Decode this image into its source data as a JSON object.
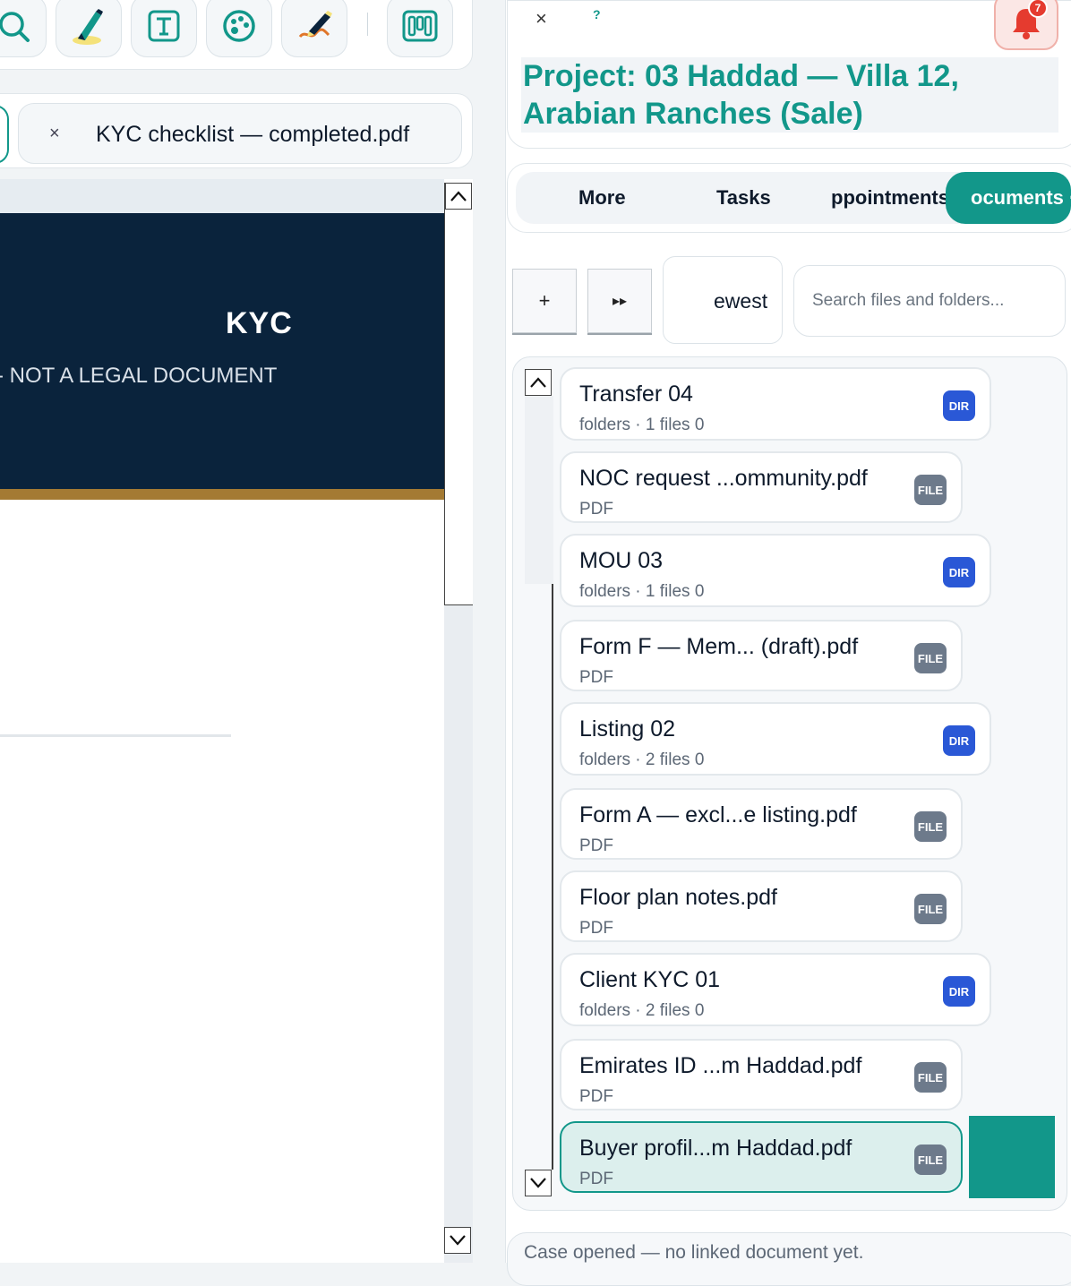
{
  "toolbar": {
    "tools": [
      {
        "icon": "search-icon"
      },
      {
        "icon": "highlighter-icon"
      },
      {
        "icon": "text-box-icon"
      },
      {
        "icon": "palette-icon"
      },
      {
        "icon": "signature-pen-icon"
      },
      {
        "icon": "columns-icon"
      }
    ]
  },
  "tabs": {
    "close_glyph": "×",
    "document_title": "KYC checklist — completed.pdf"
  },
  "viewer": {
    "heading": "KYC",
    "subheading": "- NOT A LEGAL DOCUMENT"
  },
  "header": {
    "close_glyph": "×",
    "help_glyph": "?",
    "notification_count": "7",
    "project_title_line1": "Project: 03 Haddad — Villa 12,",
    "project_title_line2": "Arabian Ranches (Sale)"
  },
  "nav": {
    "tabs": [
      {
        "label": "More",
        "active": false
      },
      {
        "label": "Tasks",
        "active": false
      },
      {
        "label": "ppointments",
        "active": false
      },
      {
        "label": "ocuments ·",
        "active": true
      }
    ]
  },
  "files_toolbar": {
    "add_label": "+",
    "forward_label": "▸▸",
    "sort_value": "ewest",
    "search_placeholder": "Search files and folders..."
  },
  "files": [
    {
      "name": "Transfer 04",
      "meta": "folders · 1 files 0",
      "badge": "DIR",
      "type": "dir"
    },
    {
      "name": "NOC request ...ommunity.pdf",
      "meta": "PDF",
      "badge": "FILE",
      "type": "file"
    },
    {
      "name": "MOU 03",
      "meta": "folders · 1 files 0",
      "badge": "DIR",
      "type": "dir"
    },
    {
      "name": "Form F — Mem... (draft).pdf",
      "meta": "PDF",
      "badge": "FILE",
      "type": "file"
    },
    {
      "name": "Listing 02",
      "meta": "folders · 2 files 0",
      "badge": "DIR",
      "type": "dir"
    },
    {
      "name": "Form A — excl...e listing.pdf",
      "meta": "PDF",
      "badge": "FILE",
      "type": "file"
    },
    {
      "name": "Floor plan notes.pdf",
      "meta": "PDF",
      "badge": "FILE",
      "type": "file"
    },
    {
      "name": "Client KYC 01",
      "meta": "folders · 2 files 0",
      "badge": "DIR",
      "type": "dir"
    },
    {
      "name": "Emirates ID ...m Haddad.pdf",
      "meta": "PDF",
      "badge": "FILE",
      "type": "file"
    },
    {
      "name": "Buyer profil...m Haddad.pdf",
      "meta": "PDF",
      "badge": "FILE",
      "type": "file",
      "selected": true
    }
  ],
  "status": {
    "text": "Case opened — no linked document yet."
  },
  "colors": {
    "accent": "#12978a",
    "navy": "#0a233c",
    "gold": "#a47a33",
    "dir_badge": "#2a58d6",
    "file_badge": "#6d7a8b",
    "alert": "#e53b2f"
  }
}
